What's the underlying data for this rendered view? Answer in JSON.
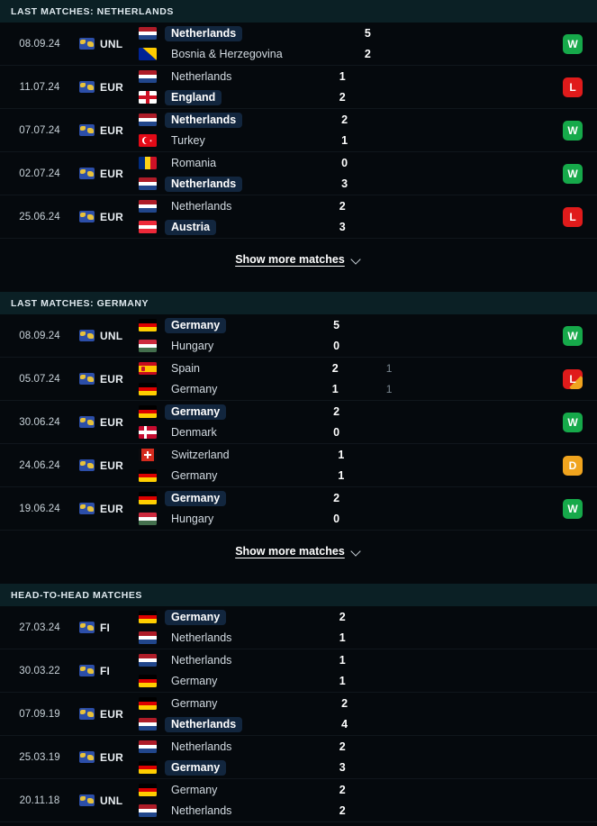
{
  "sections": [
    {
      "id": "last-matches-netherlands",
      "title": "LAST MATCHES: NETHERLANDS",
      "show_more_label": "Show more matches",
      "matches": [
        {
          "date": "08.09.24",
          "competition": "UNL",
          "home": {
            "team": "Netherlands",
            "flag": "nl",
            "winner": true,
            "score": "5",
            "extra": ""
          },
          "away": {
            "team": "Bosnia & Herzegovina",
            "flag": "ba",
            "winner": false,
            "score": "2",
            "extra": ""
          },
          "result": "W",
          "result_type": "win",
          "folded": false
        },
        {
          "date": "11.07.24",
          "competition": "EUR",
          "home": {
            "team": "Netherlands",
            "flag": "nl",
            "winner": false,
            "score": "1",
            "extra": ""
          },
          "away": {
            "team": "England",
            "flag": "en",
            "winner": true,
            "score": "2",
            "extra": ""
          },
          "result": "L",
          "result_type": "loss",
          "folded": false
        },
        {
          "date": "07.07.24",
          "competition": "EUR",
          "home": {
            "team": "Netherlands",
            "flag": "nl",
            "winner": true,
            "score": "2",
            "extra": ""
          },
          "away": {
            "team": "Turkey",
            "flag": "tr",
            "winner": false,
            "score": "1",
            "extra": ""
          },
          "result": "W",
          "result_type": "win",
          "folded": false
        },
        {
          "date": "02.07.24",
          "competition": "EUR",
          "home": {
            "team": "Romania",
            "flag": "ro",
            "winner": false,
            "score": "0",
            "extra": ""
          },
          "away": {
            "team": "Netherlands",
            "flag": "nl",
            "winner": true,
            "score": "3",
            "extra": ""
          },
          "result": "W",
          "result_type": "win",
          "folded": false
        },
        {
          "date": "25.06.24",
          "competition": "EUR",
          "home": {
            "team": "Netherlands",
            "flag": "nl",
            "winner": false,
            "score": "2",
            "extra": ""
          },
          "away": {
            "team": "Austria",
            "flag": "at",
            "winner": true,
            "score": "3",
            "extra": ""
          },
          "result": "L",
          "result_type": "loss",
          "folded": false
        }
      ]
    },
    {
      "id": "last-matches-germany",
      "title": "LAST MATCHES: GERMANY",
      "show_more_label": "Show more matches",
      "matches": [
        {
          "date": "08.09.24",
          "competition": "UNL",
          "home": {
            "team": "Germany",
            "flag": "de",
            "winner": true,
            "score": "5",
            "extra": ""
          },
          "away": {
            "team": "Hungary",
            "flag": "hu",
            "winner": false,
            "score": "0",
            "extra": ""
          },
          "result": "W",
          "result_type": "win",
          "folded": false
        },
        {
          "date": "05.07.24",
          "competition": "EUR",
          "home": {
            "team": "Spain",
            "flag": "es",
            "winner": false,
            "score": "2",
            "extra": "1"
          },
          "away": {
            "team": "Germany",
            "flag": "de",
            "winner": false,
            "score": "1",
            "extra": "1"
          },
          "result": "L",
          "result_type": "loss",
          "folded": true
        },
        {
          "date": "30.06.24",
          "competition": "EUR",
          "home": {
            "team": "Germany",
            "flag": "de",
            "winner": true,
            "score": "2",
            "extra": ""
          },
          "away": {
            "team": "Denmark",
            "flag": "dk",
            "winner": false,
            "score": "0",
            "extra": ""
          },
          "result": "W",
          "result_type": "win",
          "folded": false
        },
        {
          "date": "24.06.24",
          "competition": "EUR",
          "home": {
            "team": "Switzerland",
            "flag": "ch",
            "winner": false,
            "score": "1",
            "extra": ""
          },
          "away": {
            "team": "Germany",
            "flag": "de",
            "winner": false,
            "score": "1",
            "extra": ""
          },
          "result": "D",
          "result_type": "draw",
          "folded": false
        },
        {
          "date": "19.06.24",
          "competition": "EUR",
          "home": {
            "team": "Germany",
            "flag": "de",
            "winner": true,
            "score": "2",
            "extra": ""
          },
          "away": {
            "team": "Hungary",
            "flag": "hu",
            "winner": false,
            "score": "0",
            "extra": ""
          },
          "result": "W",
          "result_type": "win",
          "folded": false
        }
      ]
    },
    {
      "id": "head-to-head-matches",
      "title": "HEAD-TO-HEAD MATCHES",
      "show_more_label": "",
      "matches": [
        {
          "date": "27.03.24",
          "competition": "FI",
          "home": {
            "team": "Germany",
            "flag": "de",
            "winner": true,
            "score": "2",
            "extra": ""
          },
          "away": {
            "team": "Netherlands",
            "flag": "nl",
            "winner": false,
            "score": "1",
            "extra": ""
          },
          "result": "",
          "result_type": "",
          "folded": false
        },
        {
          "date": "30.03.22",
          "competition": "FI",
          "home": {
            "team": "Netherlands",
            "flag": "nl",
            "winner": false,
            "score": "1",
            "extra": ""
          },
          "away": {
            "team": "Germany",
            "flag": "de",
            "winner": false,
            "score": "1",
            "extra": ""
          },
          "result": "",
          "result_type": "",
          "folded": false
        },
        {
          "date": "07.09.19",
          "competition": "EUR",
          "home": {
            "team": "Germany",
            "flag": "de",
            "winner": false,
            "score": "2",
            "extra": ""
          },
          "away": {
            "team": "Netherlands",
            "flag": "nl",
            "winner": true,
            "score": "4",
            "extra": ""
          },
          "result": "",
          "result_type": "",
          "folded": false
        },
        {
          "date": "25.03.19",
          "competition": "EUR",
          "home": {
            "team": "Netherlands",
            "flag": "nl",
            "winner": false,
            "score": "2",
            "extra": ""
          },
          "away": {
            "team": "Germany",
            "flag": "de",
            "winner": true,
            "score": "3",
            "extra": ""
          },
          "result": "",
          "result_type": "",
          "folded": false
        },
        {
          "date": "20.11.18",
          "competition": "UNL",
          "home": {
            "team": "Germany",
            "flag": "de",
            "winner": false,
            "score": "2",
            "extra": ""
          },
          "away": {
            "team": "Netherlands",
            "flag": "nl",
            "winner": false,
            "score": "2",
            "extra": ""
          },
          "result": "",
          "result_type": "",
          "folded": false
        }
      ]
    }
  ],
  "icons": {
    "competition": "globe-icon",
    "expand": "chevron-down-icon"
  },
  "colors": {
    "win": "#16a94a",
    "loss": "#e01b1b",
    "draw": "#f0a41e",
    "header_bg": "#0b2025",
    "winner_pill": "#12263e"
  }
}
